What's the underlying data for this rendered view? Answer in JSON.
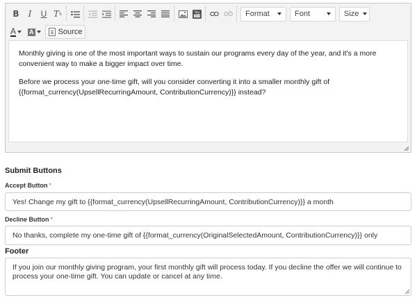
{
  "toolbar": {
    "row1": {
      "basic": [
        "bold-icon",
        "italic-icon",
        "underline-icon",
        "remove-format-icon"
      ],
      "list": [
        "bulleted-list-icon"
      ],
      "indent": [
        "decrease-indent-icon",
        "increase-indent-icon"
      ],
      "align": [
        "align-left-icon",
        "align-center-icon",
        "align-right-icon",
        "align-justify-icon"
      ],
      "insert": [
        "image-icon",
        "youtube-icon"
      ],
      "link": [
        "link-icon",
        "unlink-icon"
      ],
      "format_label": "Format",
      "font_label": "Font",
      "size_label": "Size"
    },
    "row2": {
      "text_color_glyph": "A",
      "bg_color_glyph": "A",
      "source_label": "Source"
    }
  },
  "editor": {
    "paragraph1": "Monthly giving is one of the most important ways to sustain our programs every day of the year, and it's a more convenient way to make a bigger impact over time.",
    "paragraph2_line1": "Before we process your one-time gift, will you consider converting it into a smaller monthly gift of",
    "paragraph2_line2": "{{format_currency(UpsellRecurringAmount, ContributionCurrency)}} instead?"
  },
  "submit_buttons": {
    "section_title": "Submit Buttons",
    "accept": {
      "label": "Accept Button",
      "required_mark": "*",
      "value": "Yes! Change my gift to {{format_currency(UpsellRecurringAmount, ContributionCurrency)}} a month"
    },
    "decline": {
      "label": "Decline Button",
      "required_mark": "*",
      "value": "No thanks, complete my one-time gift of {{format_currency(OriginalSelectedAmount, ContributionCurrency)}} only"
    }
  },
  "footer": {
    "section_title": "Footer",
    "value_line1": "If you join our monthly giving program, your first monthly gift will process today. If you decline the offer we will continue to",
    "value_line2": "process your one-time gift. You can update or cancel at any time."
  },
  "colors": {
    "required": "#d9534f",
    "toolbar_bg": "#f3f3f3",
    "input_border": "#c9ced3"
  }
}
